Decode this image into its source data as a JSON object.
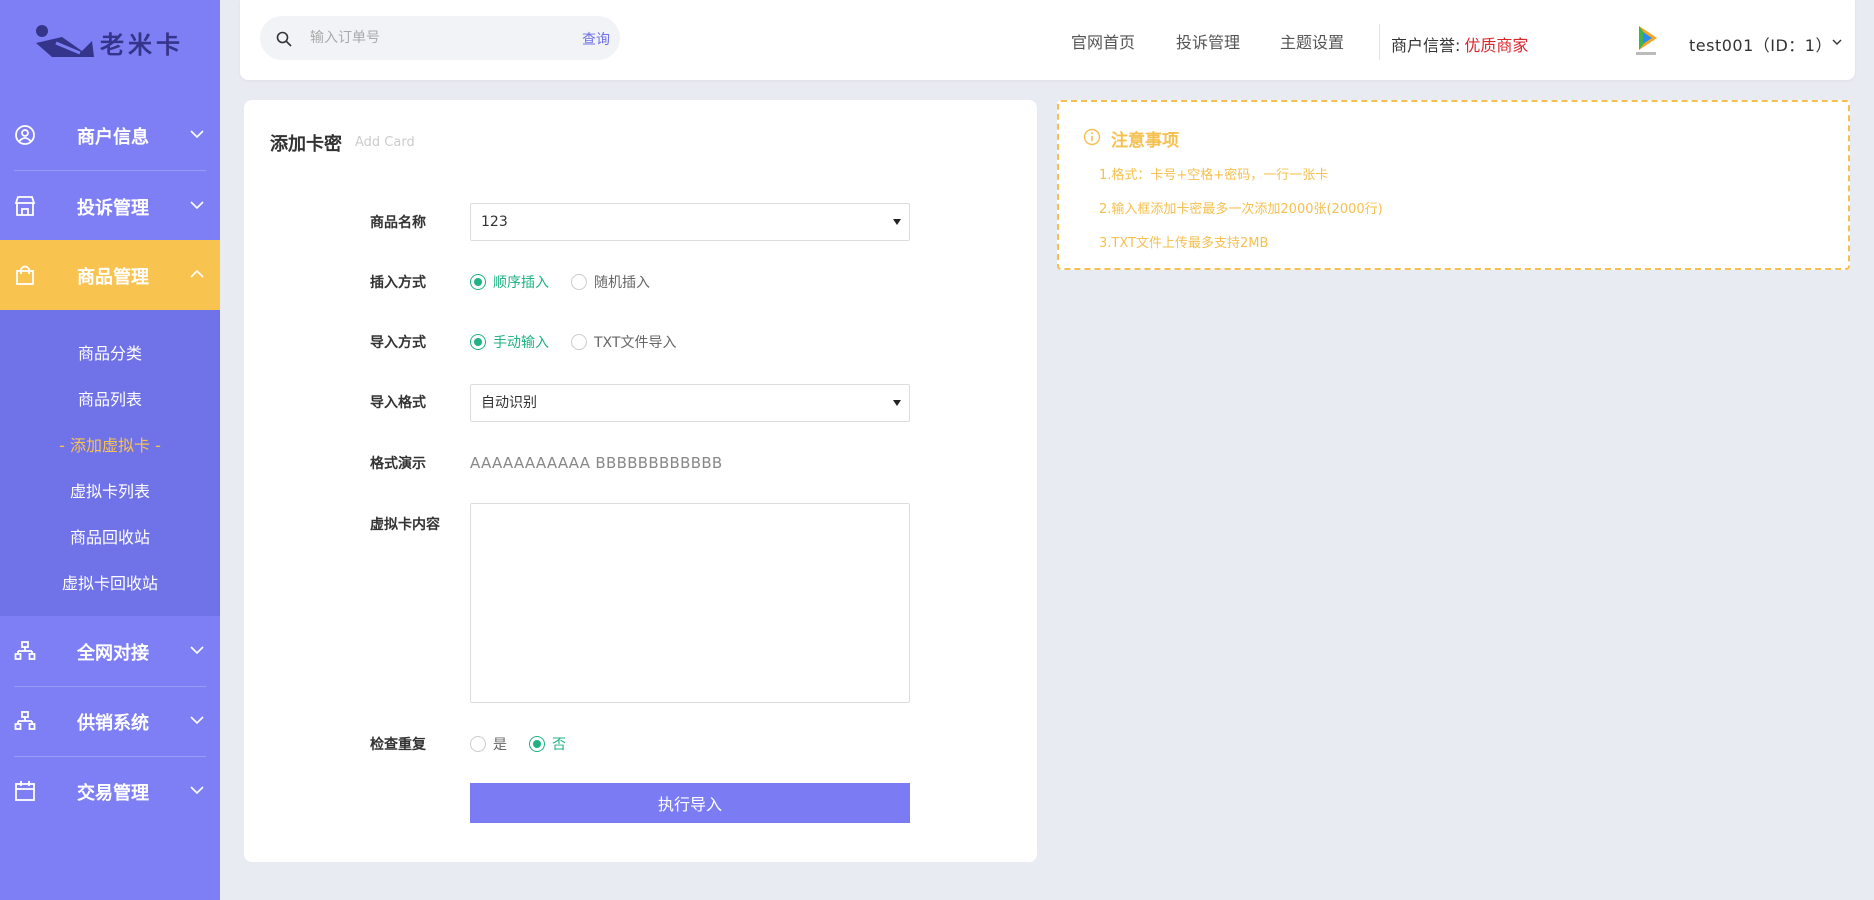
{
  "brand": {
    "logo_text": "老米卡"
  },
  "colors": {
    "sidebar_bg": "#7e7ff5",
    "active_nav": "#f8c34f",
    "accent": "#7b7cf4",
    "radio_checked": "#20b284",
    "reputation_value": "#d9272e",
    "notice_border": "#f5c04f"
  },
  "sidebar": {
    "items": [
      {
        "label": "商户信息",
        "icon": "user-circle-icon",
        "expanded": false
      },
      {
        "label": "投诉管理",
        "icon": "store-icon",
        "expanded": false
      },
      {
        "label": "商品管理",
        "icon": "shopping-bag-icon",
        "expanded": true
      },
      {
        "label": "全网对接",
        "icon": "network-icon",
        "expanded": false
      },
      {
        "label": "供销系统",
        "icon": "network-icon",
        "expanded": false
      },
      {
        "label": "交易管理",
        "icon": "calendar-icon",
        "expanded": false
      }
    ],
    "submenu": [
      {
        "label": "商品分类"
      },
      {
        "label": "商品列表"
      },
      {
        "label": "- 添加虚拟卡 -"
      },
      {
        "label": "虚拟卡列表"
      },
      {
        "label": "商品回收站"
      },
      {
        "label": "虚拟卡回收站"
      }
    ]
  },
  "header": {
    "search": {
      "placeholder": "输入订单号",
      "value": "",
      "button_label": "查询"
    },
    "links": [
      {
        "label": "官网首页"
      },
      {
        "label": "投诉管理"
      },
      {
        "label": "主题设置"
      }
    ],
    "reputation_label": "商户信誉:",
    "reputation_value": "优质商家",
    "user_label": "test001（ID：1）"
  },
  "form": {
    "title": "添加卡密",
    "subtitle": "Add Card",
    "product_name_label": "商品名称",
    "product_name_value": "123",
    "insert_mode_label": "插入方式",
    "insert_mode_options": [
      {
        "label": "顺序插入",
        "checked": true
      },
      {
        "label": "随机插入",
        "checked": false
      }
    ],
    "import_mode_label": "导入方式",
    "import_mode_options": [
      {
        "label": "手动输入",
        "checked": true
      },
      {
        "label": "TXT文件导入",
        "checked": false
      }
    ],
    "import_format_label": "导入格式",
    "import_format_value": "自动识别",
    "format_demo_label": "格式演示",
    "format_demo_value": "AAAAAAAAAAA BBBBBBBBBBBB",
    "content_label": "虚拟卡内容",
    "content_value": "",
    "check_dup_label": "检查重复",
    "check_dup_options": [
      {
        "label": "是",
        "checked": false
      },
      {
        "label": "否",
        "checked": true
      }
    ],
    "submit_label": "执行导入"
  },
  "notice": {
    "title": "注意事项",
    "items": [
      "1.格式：卡号+空格+密码，一行一张卡",
      "2.输入框添加卡密最多一次添加2000张(2000行)",
      "3.TXT文件上传最多支持2MB"
    ]
  }
}
